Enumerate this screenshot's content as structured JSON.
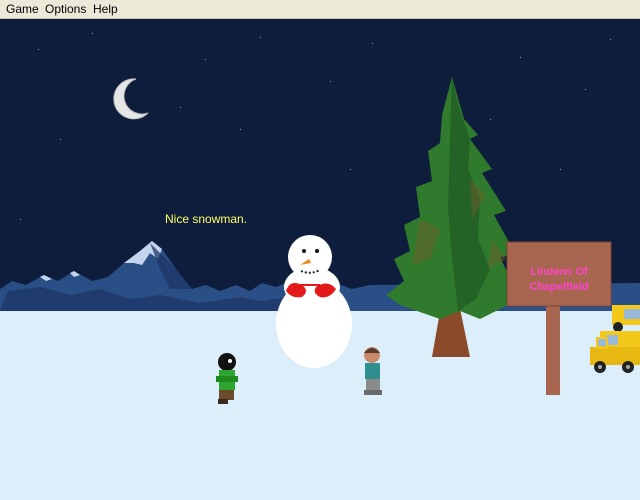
{
  "menu": {
    "game": "Game",
    "options": "Options",
    "help": "Help"
  },
  "scene": {
    "dialog": "Nice snowman.",
    "sign_text": "Lindens Of Chapelfield"
  },
  "colors": {
    "sky": "#0e1d3b",
    "snow": "#dceefa",
    "dialog_text": "#ffff66",
    "sign_board": "#a86650",
    "sign_text": "#ff44cc"
  }
}
